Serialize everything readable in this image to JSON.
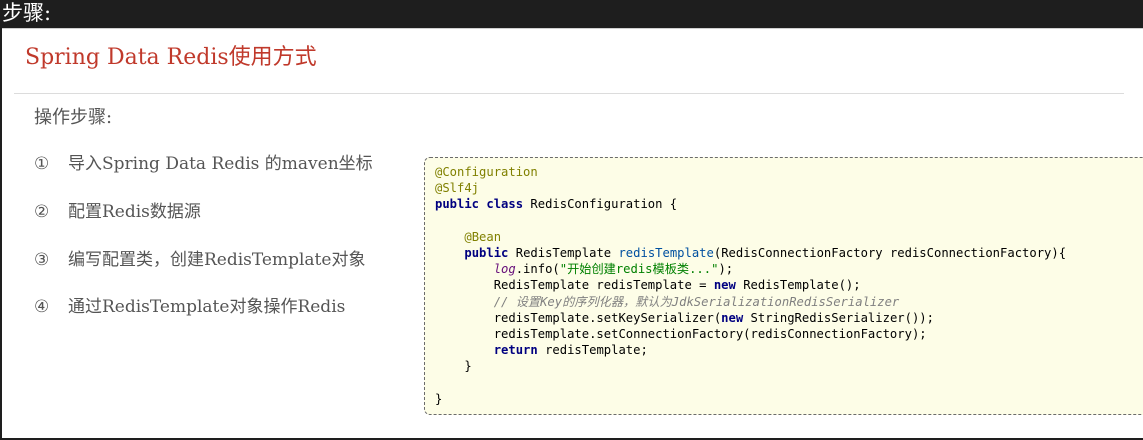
{
  "header": {
    "title": "步骤:"
  },
  "section": {
    "title": "Spring Data Redis使用方式",
    "steps_heading": "操作步骤:",
    "steps": [
      {
        "num": "①",
        "text": "导入Spring Data Redis 的maven坐标"
      },
      {
        "num": "②",
        "text": "配置Redis数据源"
      },
      {
        "num": "③",
        "text": "编写配置类，创建RedisTemplate对象"
      },
      {
        "num": "④",
        "text": "通过RedisTemplate对象操作Redis"
      }
    ]
  },
  "code": {
    "l1": "@Configuration",
    "l2": "@Slf4j",
    "l3_kw": "public class ",
    "l3_rest": "RedisConfiguration {",
    "l5_ann": "@Bean",
    "l6_kw": "public ",
    "l6_type": "RedisTemplate ",
    "l6_fn": "redisTemplate",
    "l6_rest": "(RedisConnectionFactory redisConnectionFactory){",
    "l7_log": "log",
    "l7_mid": ".info(",
    "l7_str": "\"开始创建redis模板类...\"",
    "l7_end": ");",
    "l8_a": "RedisTemplate redisTemplate = ",
    "l8_kw": "new ",
    "l8_b": "RedisTemplate();",
    "l9_cmt": "// 设置Key的序列化器，默认为JdkSerializationRedisSerializer",
    "l10_a": "redisTemplate.setKeySerializer(",
    "l10_kw": "new ",
    "l10_b": "StringRedisSerializer());",
    "l11": "redisTemplate.setConnectionFactory(redisConnectionFactory);",
    "l12_kw": "return ",
    "l12_rest": "redisTemplate;",
    "l13": "}",
    "l15": "}"
  },
  "colors": {
    "title_red": "#c0392b",
    "code_bg": "#fdfde7",
    "annotation": "#808000",
    "keyword": "#000080",
    "string": "#008000",
    "comment": "#808080"
  }
}
